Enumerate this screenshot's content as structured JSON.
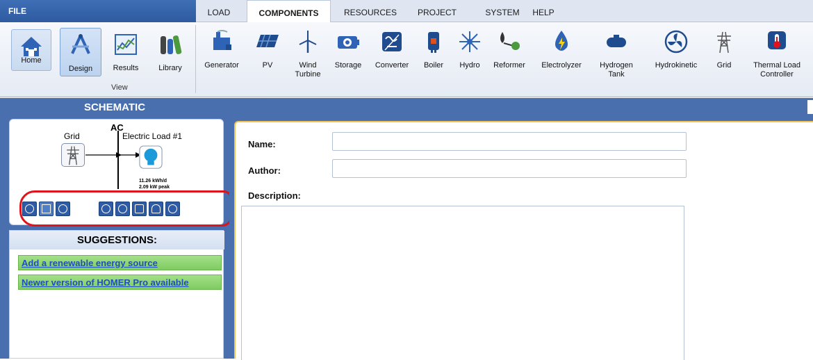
{
  "tabs": {
    "file": "FILE",
    "items": [
      "LOAD",
      "COMPONENTS",
      "RESOURCES",
      "PROJECT",
      "SYSTEM",
      "HELP"
    ],
    "active": "COMPONENTS"
  },
  "ribbon": {
    "view_buttons": {
      "home": "Home",
      "design": "Design",
      "results": "Results",
      "library": "Library"
    },
    "view_group_label": "View",
    "components": [
      "Generator",
      "PV",
      "Wind Turbine",
      "Storage",
      "Converter",
      "Boiler",
      "Hydro",
      "Reformer",
      "Electrolyzer",
      "Hydrogen Tank",
      "Hydrokinetic",
      "Grid",
      "Thermal Load Controller"
    ]
  },
  "schematic": {
    "title": "SCHEMATIC",
    "bus_label": "AC",
    "grid_label": "Grid",
    "load_label": "Electric Load #1",
    "load_energy": "11.26 kWh/d",
    "load_peak": "2.09 kW peak"
  },
  "suggestions": {
    "title": "SUGGESTIONS:",
    "items": [
      "Add a renewable energy source",
      "Newer version of HOMER Pro available"
    ]
  },
  "form": {
    "name_label": "Name:",
    "author_label": "Author:",
    "description_label": "Description:",
    "name_value": "",
    "author_value": ""
  },
  "colors": {
    "panel_blue": "#4a6fae",
    "highlight_red": "#e0121a",
    "suggestion_green": "#7fcc60",
    "form_border": "#f3c252"
  }
}
